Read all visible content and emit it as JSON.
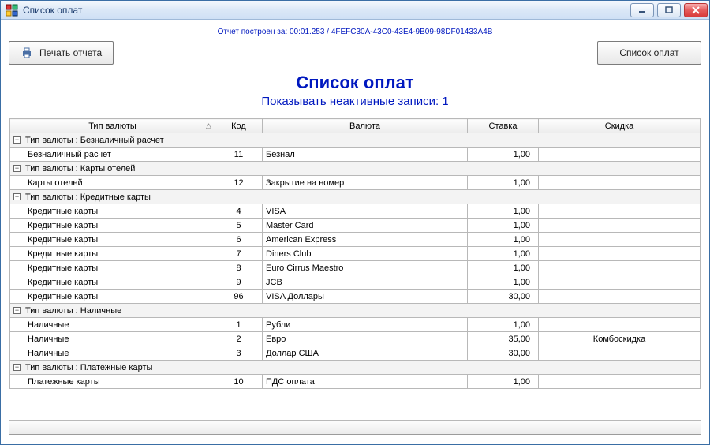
{
  "window": {
    "title": "Список оплат"
  },
  "report_info": "Отчет построен за: 00:01.253 / 4FEFC30A-43C0-43E4-9B09-98DF01433A4B",
  "buttons": {
    "print": "Печать отчета",
    "list": "Список оплат"
  },
  "heading": "Список оплат",
  "subheading": "Показывать неактивные записи: 1",
  "columns": {
    "type": "Тип валюты",
    "code": "Код",
    "currency": "Валюта",
    "rate": "Ставка",
    "discount": "Скидка"
  },
  "group_prefix": "Тип валюты : ",
  "groups": [
    {
      "name": "Безналичный расчет",
      "rows": [
        {
          "type": "Безналичный расчет",
          "code": "11",
          "currency": "Безнал",
          "rate": "1,00",
          "discount": ""
        }
      ]
    },
    {
      "name": "Карты отелей",
      "rows": [
        {
          "type": "Карты отелей",
          "code": "12",
          "currency": "Закрытие на номер",
          "rate": "1,00",
          "discount": ""
        }
      ]
    },
    {
      "name": "Кредитные карты",
      "rows": [
        {
          "type": "Кредитные карты",
          "code": "4",
          "currency": "VISA",
          "rate": "1,00",
          "discount": ""
        },
        {
          "type": "Кредитные карты",
          "code": "5",
          "currency": "Master Card",
          "rate": "1,00",
          "discount": ""
        },
        {
          "type": "Кредитные карты",
          "code": "6",
          "currency": "American Express",
          "rate": "1,00",
          "discount": ""
        },
        {
          "type": "Кредитные карты",
          "code": "7",
          "currency": "Diners Club",
          "rate": "1,00",
          "discount": ""
        },
        {
          "type": "Кредитные карты",
          "code": "8",
          "currency": "Euro Cirrus Maestro",
          "rate": "1,00",
          "discount": ""
        },
        {
          "type": "Кредитные карты",
          "code": "9",
          "currency": "JCB",
          "rate": "1,00",
          "discount": ""
        },
        {
          "type": "Кредитные карты",
          "code": "96",
          "currency": "VISA Доллары",
          "rate": "30,00",
          "discount": ""
        }
      ]
    },
    {
      "name": "Наличные",
      "rows": [
        {
          "type": "Наличные",
          "code": "1",
          "currency": "Рубли",
          "rate": "1,00",
          "discount": ""
        },
        {
          "type": "Наличные",
          "code": "2",
          "currency": "Евро",
          "rate": "35,00",
          "discount": "Комбоскидка"
        },
        {
          "type": "Наличные",
          "code": "3",
          "currency": "Доллар США",
          "rate": "30,00",
          "discount": ""
        }
      ]
    },
    {
      "name": "Платежные карты",
      "rows": [
        {
          "type": "Платежные карты",
          "code": "10",
          "currency": "ПДС оплата",
          "rate": "1,00",
          "discount": ""
        }
      ]
    }
  ]
}
